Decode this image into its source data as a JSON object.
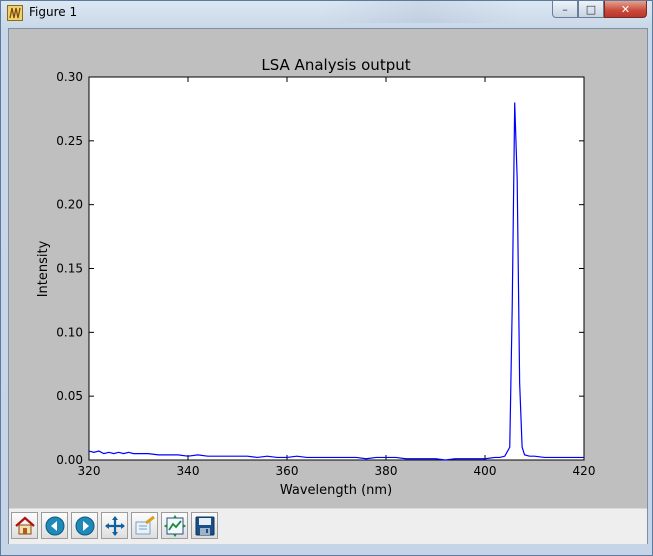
{
  "window": {
    "title": "Figure 1",
    "minimize_glyph": "–",
    "maximize_glyph": "□",
    "close_glyph": "✕"
  },
  "toolbar": {
    "buttons": [
      {
        "name": "home-button",
        "icon": "home-icon"
      },
      {
        "name": "back-button",
        "icon": "arrow-left-icon"
      },
      {
        "name": "forward-button",
        "icon": "arrow-right-icon"
      },
      {
        "name": "pan-button",
        "icon": "move-arrows-icon"
      },
      {
        "name": "zoom-button",
        "icon": "zoom-rect-icon"
      },
      {
        "name": "subplots-button",
        "icon": "subplots-icon"
      },
      {
        "name": "save-button",
        "icon": "floppy-disk-icon"
      }
    ]
  },
  "colors": {
    "line": "#0000ff",
    "figure_bg": "#bfbfbf",
    "axes_bg": "#ffffff"
  },
  "chart_data": {
    "type": "line",
    "title": "LSA Analysis output",
    "xlabel": "Wavelength (nm)",
    "ylabel": "Intensity",
    "xlim": [
      320,
      420
    ],
    "ylim": [
      0.0,
      0.3
    ],
    "xticks": [
      320,
      340,
      360,
      380,
      400,
      420
    ],
    "xtick_labels": [
      "320",
      "340",
      "360",
      "380",
      "400",
      "420"
    ],
    "yticks": [
      0.0,
      0.05,
      0.1,
      0.15,
      0.2,
      0.25,
      0.3
    ],
    "ytick_labels": [
      "0.00",
      "0.05",
      "0.10",
      "0.15",
      "0.20",
      "0.25",
      "0.30"
    ],
    "grid": false,
    "series": [
      {
        "x": [
          320,
          321,
          322,
          323,
          324,
          325,
          326,
          327,
          328,
          329,
          330,
          332,
          334,
          336,
          338,
          340,
          342,
          344,
          346,
          348,
          350,
          352,
          354,
          356,
          358,
          360,
          362,
          364,
          366,
          368,
          370,
          372,
          374,
          376,
          378,
          380,
          382,
          384,
          386,
          388,
          390,
          392,
          394,
          396,
          398,
          400,
          402,
          403,
          404,
          405,
          405.5,
          406,
          406.5,
          407,
          407.5,
          408,
          409,
          410,
          412,
          414,
          416,
          418,
          420
        ],
        "y": [
          0.007,
          0.006,
          0.007,
          0.005,
          0.006,
          0.005,
          0.006,
          0.005,
          0.006,
          0.005,
          0.005,
          0.005,
          0.004,
          0.004,
          0.004,
          0.003,
          0.004,
          0.003,
          0.003,
          0.003,
          0.003,
          0.003,
          0.002,
          0.003,
          0.002,
          0.002,
          0.003,
          0.002,
          0.002,
          0.002,
          0.002,
          0.002,
          0.002,
          0.001,
          0.002,
          0.002,
          0.002,
          0.001,
          0.001,
          0.001,
          0.001,
          0.0,
          0.001,
          0.001,
          0.001,
          0.001,
          0.002,
          0.002,
          0.003,
          0.01,
          0.12,
          0.28,
          0.22,
          0.06,
          0.01,
          0.004,
          0.003,
          0.003,
          0.002,
          0.002,
          0.002,
          0.002,
          0.002
        ]
      }
    ]
  }
}
